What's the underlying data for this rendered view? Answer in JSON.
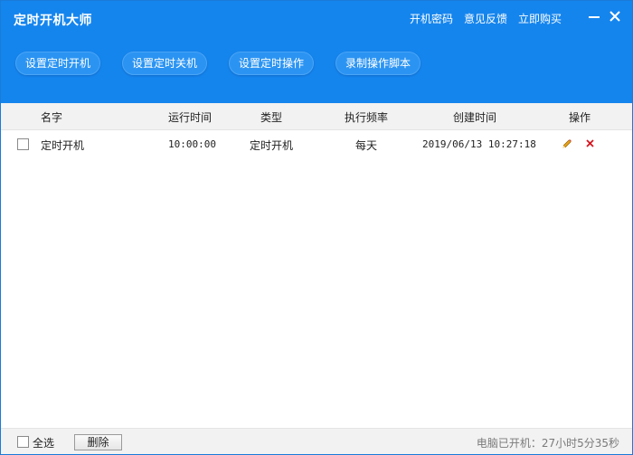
{
  "window": {
    "title": "定时开机大师",
    "accent_color": "#1585ee"
  },
  "header": {
    "links": {
      "boot_password": "开机密码",
      "feedback": "意见反馈",
      "buy_now": "立即购买"
    },
    "window_controls": {
      "minimize_icon": "minimize-icon",
      "close_icon": "close-icon"
    }
  },
  "toolbar": {
    "buttons": [
      {
        "label": "设置定时开机"
      },
      {
        "label": "设置定时关机"
      },
      {
        "label": "设置定时操作"
      },
      {
        "label": "录制操作脚本"
      }
    ]
  },
  "table": {
    "columns": {
      "name": "名字",
      "run_time": "运行时间",
      "type": "类型",
      "frequency": "执行频率",
      "created": "创建时间",
      "actions": "操作"
    },
    "rows": [
      {
        "checked": false,
        "name": "定时开机",
        "run_time": "10:00:00",
        "type": "定时开机",
        "frequency": "每天",
        "created": "2019/06/13 10:27:18",
        "edit_icon": "pencil-icon",
        "delete_icon": "delete-x-icon"
      }
    ]
  },
  "footer": {
    "select_all_label": "全选",
    "select_all_checked": false,
    "delete_label": "删除",
    "uptime": "电脑已开机：27小时5分35秒"
  }
}
